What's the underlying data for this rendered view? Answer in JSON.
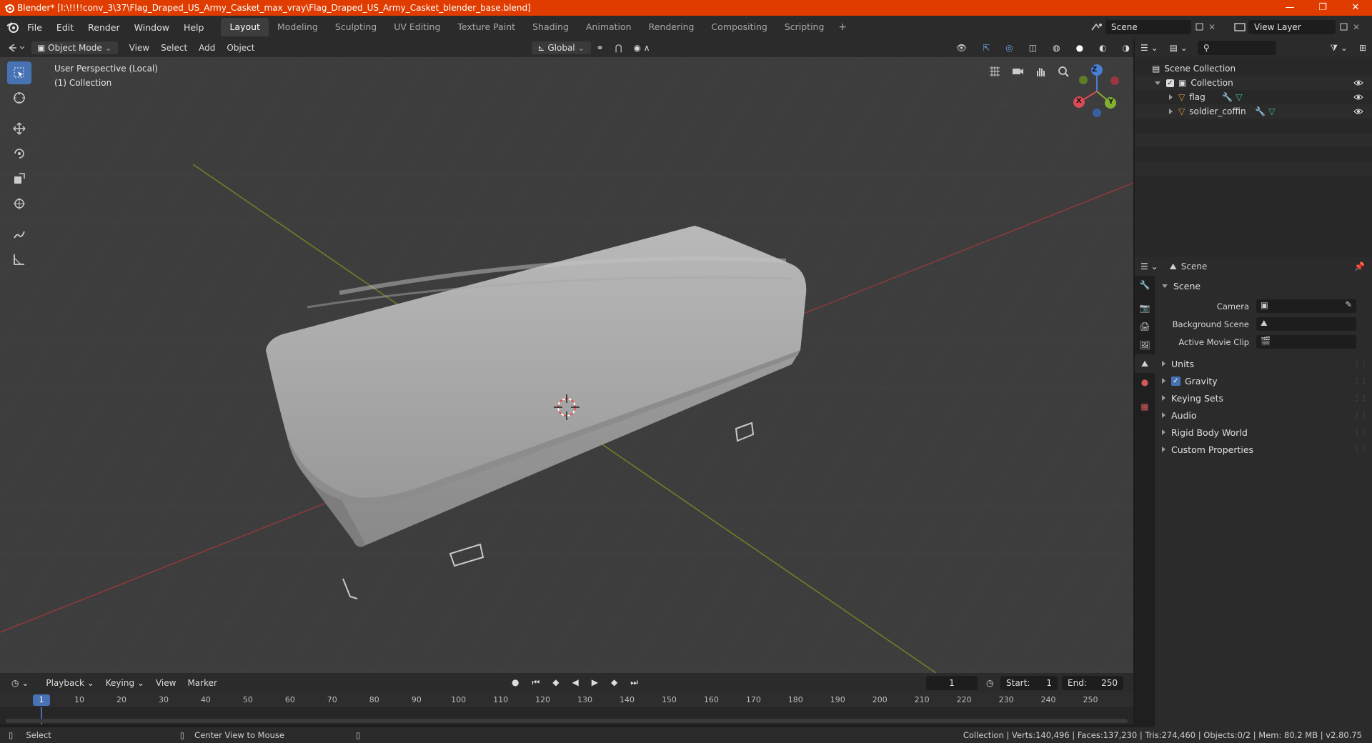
{
  "window": {
    "title": "Blender* [I:\\!!!!conv_3\\37\\Flag_Draped_US_Army_Casket_max_vray\\Flag_Draped_US_Army_Casket_blender_base.blend]",
    "controls": [
      "—",
      "❐",
      "✕"
    ]
  },
  "menu": {
    "items": [
      "File",
      "Edit",
      "Render",
      "Window",
      "Help"
    ]
  },
  "workspaces": {
    "tabs": [
      "Layout",
      "Modeling",
      "Sculpting",
      "UV Editing",
      "Texture Paint",
      "Shading",
      "Animation",
      "Rendering",
      "Compositing",
      "Scripting"
    ],
    "active": "Layout",
    "add": "+"
  },
  "scene_selector": {
    "value": "Scene"
  },
  "view_layer_selector": {
    "value": "View Layer"
  },
  "viewport_header": {
    "mode": "Object Mode",
    "menus": [
      "View",
      "Select",
      "Add",
      "Object"
    ],
    "orientation": "Global"
  },
  "viewport": {
    "info_line1": "User Perspective (Local)",
    "info_line2": "(1) Collection",
    "gizmo_axes": {
      "x": "X",
      "y": "Y",
      "z": "Z"
    },
    "colors": {
      "background": "#3d3d3d",
      "x_axis": "#c8464b",
      "y_axis": "#7a9a27",
      "accent": "#4772b3"
    }
  },
  "tools": [
    "select-box",
    "cursor",
    "move",
    "rotate",
    "scale",
    "transform",
    "annotate",
    "measure"
  ],
  "outliner": {
    "root": "Scene Collection",
    "collection": "Collection",
    "objects": [
      "flag",
      "soldier_coffin"
    ]
  },
  "properties": {
    "header": "Scene",
    "section_title": "Scene",
    "fields": [
      {
        "label": "Camera",
        "value": ""
      },
      {
        "label": "Background Scene",
        "value": ""
      },
      {
        "label": "Active Movie Clip",
        "value": ""
      }
    ],
    "panels": [
      {
        "label": "Units",
        "checkbox": null
      },
      {
        "label": "Gravity",
        "checkbox": true
      },
      {
        "label": "Keying Sets",
        "checkbox": null
      },
      {
        "label": "Audio",
        "checkbox": null
      },
      {
        "label": "Rigid Body World",
        "checkbox": null
      },
      {
        "label": "Custom Properties",
        "checkbox": null
      }
    ]
  },
  "timeline": {
    "menus": [
      "Playback",
      "Keying",
      "View",
      "Marker"
    ],
    "current_frame": "1",
    "start_label": "Start:",
    "start": "1",
    "end_label": "End:",
    "end": "250",
    "ruler": [
      "1",
      "10",
      "20",
      "30",
      "40",
      "50",
      "60",
      "70",
      "80",
      "90",
      "100",
      "110",
      "120",
      "130",
      "140",
      "150",
      "160",
      "170",
      "180",
      "190",
      "200",
      "210",
      "220",
      "230",
      "240",
      "250"
    ]
  },
  "statusbar": {
    "left_action": "Select",
    "middle_action": "Center View to Mouse",
    "stats": "Collection | Verts:140,496 | Faces:137,230 | Tris:274,460 | Objects:0/2 | Mem: 80.2 MB | v2.80.75"
  }
}
